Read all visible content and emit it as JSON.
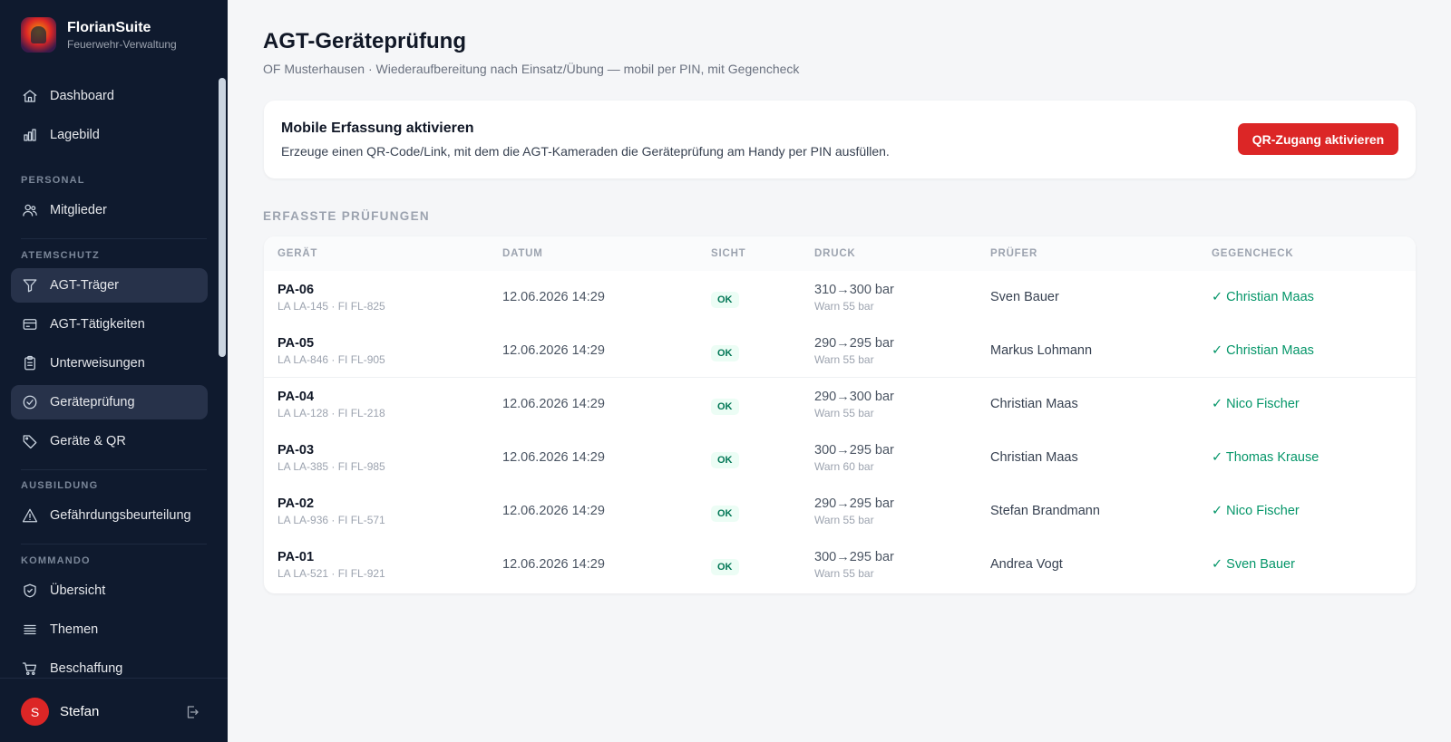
{
  "brand": {
    "title": "FlorianSuite",
    "subtitle": "Feuerwehr-Verwaltung"
  },
  "sidebar": {
    "items": [
      {
        "label": "Dashboard",
        "icon": "home-icon"
      },
      {
        "label": "Lagebild",
        "icon": "bar-chart-icon"
      },
      {
        "label": "Mitglieder",
        "icon": "users-icon"
      },
      {
        "label": "AGT-Träger",
        "icon": "filter-icon",
        "active": true
      },
      {
        "label": "AGT-Tätigkeiten",
        "icon": "card-icon"
      },
      {
        "label": "Unterweisungen",
        "icon": "clipboard-icon"
      },
      {
        "label": "Geräteprüfung",
        "icon": "check-circle-icon",
        "active": true
      },
      {
        "label": "Geräte & QR",
        "icon": "tag-icon"
      },
      {
        "label": "Gefährdungsbeurteilung",
        "icon": "warning-icon"
      },
      {
        "label": "Übersicht",
        "icon": "shield-check-icon"
      },
      {
        "label": "Themen",
        "icon": "list-icon"
      },
      {
        "label": "Beschaffung",
        "icon": "cart-icon"
      }
    ],
    "sections": [
      "PERSONAL",
      "ATEMSCHUTZ",
      "AUSBILDUNG",
      "KOMMANDO"
    ]
  },
  "user": {
    "initial": "S",
    "name": "Stefan"
  },
  "header": {
    "title": "AGT-Geräteprüfung",
    "subtitle": "OF Musterhausen · Wiederaufbereitung nach Einsatz/Übung — mobil per PIN, mit Gegencheck"
  },
  "mobile_card": {
    "title": "Mobile Erfassung aktivieren",
    "description": "Erzeuge einen QR-Code/Link, mit dem die AGT-Kameraden die Geräteprüfung am Handy per PIN ausfüllen.",
    "button": "QR-Zugang aktivieren"
  },
  "table": {
    "section_label": "ERFASSTE PRÜFUNGEN",
    "columns": [
      "GERÄT",
      "DATUM",
      "SICHT",
      "DRUCK",
      "PRÜFER",
      "GEGENCHECK"
    ],
    "rows": [
      {
        "device": "PA-06",
        "sub": "LA LA-145 · FI FL-825",
        "date": "12.06.2026 14:29",
        "sicht": "OK",
        "druck": "310→300 bar",
        "warn": "Warn 55 bar",
        "pruefer": "Sven Bauer",
        "gegencheck": "✓ Christian Maas"
      },
      {
        "device": "PA-05",
        "sub": "LA LA-846 · FI FL-905",
        "date": "12.06.2026 14:29",
        "sicht": "OK",
        "druck": "290→295 bar",
        "warn": "Warn 55 bar",
        "pruefer": "Markus Lohmann",
        "gegencheck": "✓ Christian Maas"
      },
      {
        "device": "PA-04",
        "sub": "LA LA-128 · FI FL-218",
        "date": "12.06.2026 14:29",
        "sicht": "OK",
        "druck": "290→300 bar",
        "warn": "Warn 55 bar",
        "pruefer": "Christian Maas",
        "gegencheck": "✓ Nico Fischer"
      },
      {
        "device": "PA-03",
        "sub": "LA LA-385 · FI FL-985",
        "date": "12.06.2026 14:29",
        "sicht": "OK",
        "druck": "300→295 bar",
        "warn": "Warn 60 bar",
        "pruefer": "Christian Maas",
        "gegencheck": "✓ Thomas Krause"
      },
      {
        "device": "PA-02",
        "sub": "LA LA-936 · FI FL-571",
        "date": "12.06.2026 14:29",
        "sicht": "OK",
        "druck": "290→295 bar",
        "warn": "Warn 55 bar",
        "pruefer": "Stefan Brandmann",
        "gegencheck": "✓ Nico Fischer"
      },
      {
        "device": "PA-01",
        "sub": "LA LA-521 · FI FL-921",
        "date": "12.06.2026 14:29",
        "sicht": "OK",
        "druck": "300→295 bar",
        "warn": "Warn 55 bar",
        "pruefer": "Andrea Vogt",
        "gegencheck": "✓ Sven Bauer"
      }
    ]
  },
  "colors": {
    "sidebar_bg": "#0f1a2e",
    "accent_red": "#dc2626",
    "ok_green": "#059669"
  }
}
